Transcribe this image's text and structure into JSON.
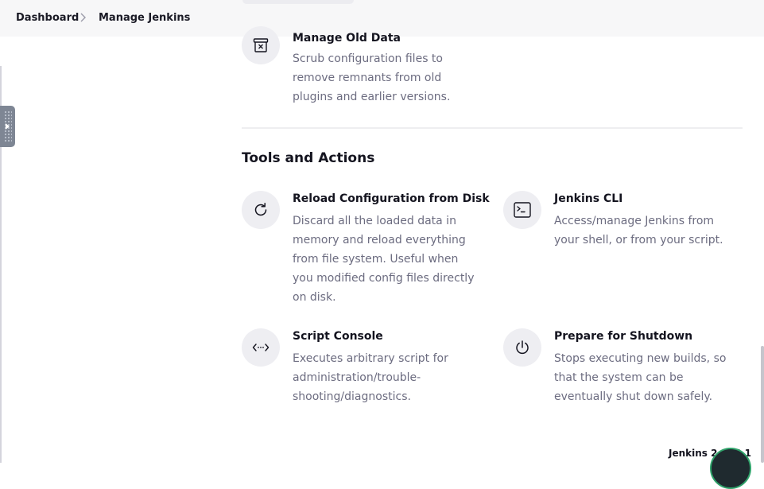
{
  "breadcrumb": {
    "items": [
      "Dashboard",
      "Manage Jenkins"
    ]
  },
  "top_item": {
    "title": "Manage Old Data",
    "description": "Scrub configuration files to remove remnants from old plugins and earlier versions.",
    "icon": "archive-x-icon"
  },
  "section": {
    "title": "Tools and Actions",
    "items": [
      {
        "title": "Reload Configuration from Disk",
        "description": "Discard all the loaded data in memory and reload everything from file system. Useful when you modified config files directly on disk.",
        "icon": "reload-icon"
      },
      {
        "title": "Jenkins CLI",
        "description": "Access/manage Jenkins from your shell, or from your script.",
        "icon": "terminal-icon"
      },
      {
        "title": "Script Console",
        "description": "Executes arbitrary script for administration/trouble-shooting/diagnostics.",
        "icon": "code-icon"
      },
      {
        "title": "Prepare for Shutdown",
        "description": "Stops executing new builds, so that the system can be eventually shut down safely.",
        "icon": "power-icon"
      }
    ]
  },
  "footer": {
    "version": "Jenkins 2.414.1"
  }
}
